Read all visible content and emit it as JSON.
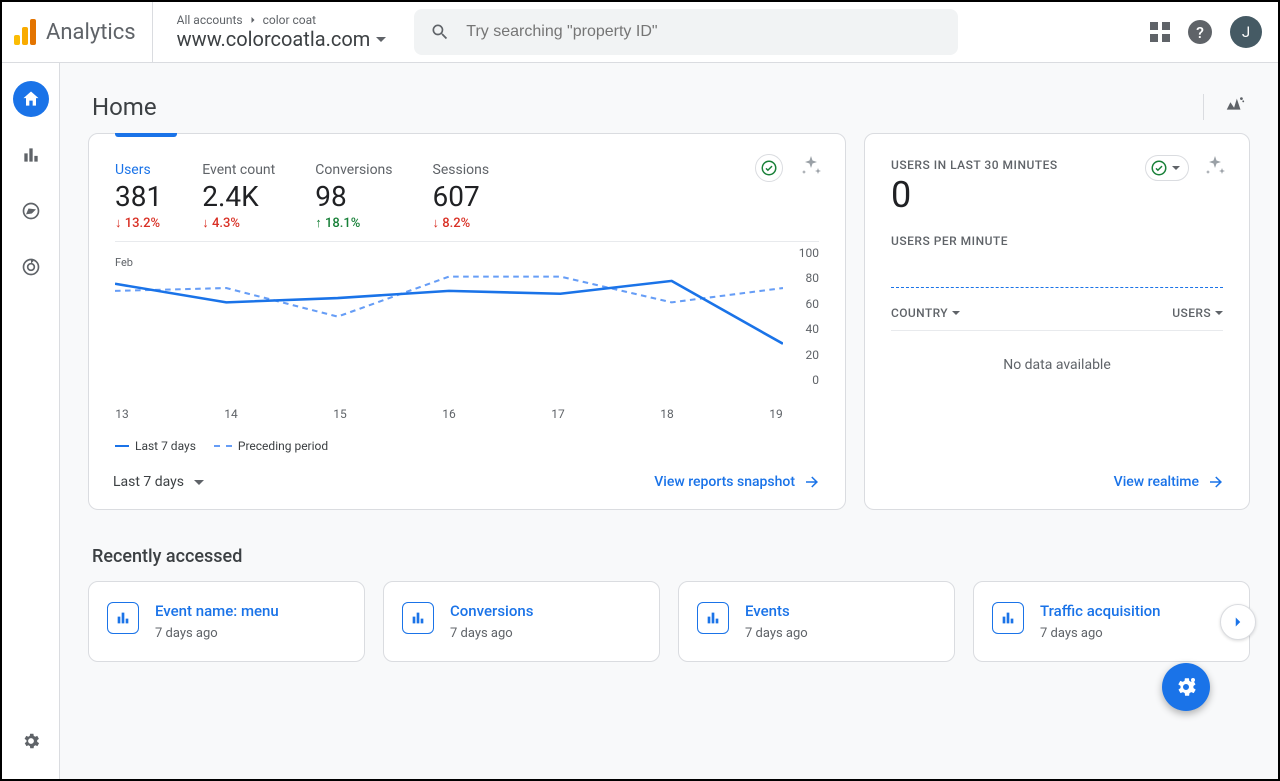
{
  "header": {
    "product": "Analytics",
    "breadcrumb_root": "All accounts",
    "breadcrumb_account": "color coat",
    "property": "www.colorcoatla.com",
    "search_placeholder": "Try searching \"property ID\"",
    "avatar_initial": "J"
  },
  "nav": {
    "items": [
      "home",
      "reports",
      "explore",
      "advertising"
    ],
    "active": "home"
  },
  "page": {
    "title": "Home"
  },
  "overview": {
    "metrics": [
      {
        "label": "Users",
        "value": "381",
        "delta": "13.2%",
        "dir": "down"
      },
      {
        "label": "Event count",
        "value": "2.4K",
        "delta": "4.3%",
        "dir": "down"
      },
      {
        "label": "Conversions",
        "value": "98",
        "delta": "18.1%",
        "dir": "up"
      },
      {
        "label": "Sessions",
        "value": "607",
        "delta": "8.2%",
        "dir": "down"
      }
    ],
    "active_metric": 0,
    "y_ticks": [
      "100",
      "80",
      "60",
      "40",
      "20",
      "0"
    ],
    "x_ticks": [
      "13",
      "14",
      "15",
      "16",
      "17",
      "18",
      "19"
    ],
    "x_month": "Feb",
    "legend_current": "Last 7 days",
    "legend_prev": "Preceding period",
    "date_range_label": "Last 7 days",
    "link_label": "View reports snapshot"
  },
  "realtime": {
    "heading": "USERS IN LAST 30 MINUTES",
    "value": "0",
    "sub_heading": "USERS PER MINUTE",
    "col_country": "COUNTRY",
    "col_users": "USERS",
    "no_data": "No data available",
    "link_label": "View realtime"
  },
  "recent": {
    "title": "Recently accessed",
    "items": [
      {
        "title": "Event name: menu",
        "sub": "7 days ago"
      },
      {
        "title": "Conversions",
        "sub": "7 days ago"
      },
      {
        "title": "Events",
        "sub": "7 days ago"
      },
      {
        "title": "Traffic acquisition",
        "sub": "7 days ago"
      }
    ]
  },
  "chart_data": {
    "type": "line",
    "xlabel": "",
    "ylabel": "",
    "ylim": [
      0,
      100
    ],
    "categories": [
      "13",
      "14",
      "15",
      "16",
      "17",
      "18",
      "19"
    ],
    "x_month": "Feb",
    "series": [
      {
        "name": "Last 7 days",
        "values": [
          75,
          62,
          65,
          70,
          68,
          77,
          33
        ]
      },
      {
        "name": "Preceding period",
        "values": [
          70,
          72,
          52,
          80,
          80,
          62,
          72
        ]
      }
    ]
  }
}
